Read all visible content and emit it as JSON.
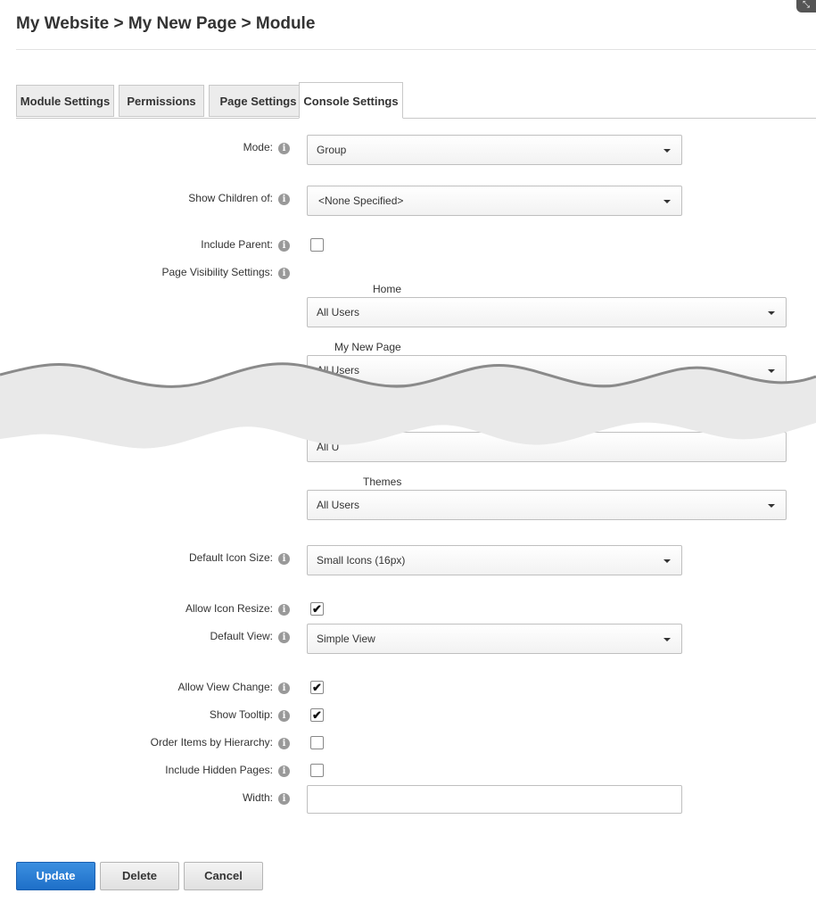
{
  "breadcrumb": "My Website > My New Page > Module",
  "tabs": [
    {
      "label": "Module Settings"
    },
    {
      "label": "Permissions"
    },
    {
      "label": "Page Settings"
    },
    {
      "label": "Console Settings"
    }
  ],
  "active_tab": "Console Settings",
  "form": {
    "mode": {
      "label": "Mode:",
      "value": "Group"
    },
    "show_children": {
      "label": "Show Children of:",
      "value": "<None Specified>"
    },
    "include_parent": {
      "label": "Include Parent:",
      "checked": false
    },
    "page_visibility": {
      "label": "Page Visibility Settings:",
      "pages": [
        {
          "name": "Home",
          "value": "All Users"
        },
        {
          "name": "My New Page",
          "value": "All Users"
        },
        {
          "name": "",
          "value": "All U"
        },
        {
          "name": "Themes",
          "value": "All Users"
        }
      ]
    },
    "default_icon_size": {
      "label": "Default Icon Size:",
      "value": "Small Icons (16px)"
    },
    "allow_icon_resize": {
      "label": "Allow Icon Resize:",
      "checked": true
    },
    "default_view": {
      "label": "Default View:",
      "value": "Simple View"
    },
    "allow_view_change": {
      "label": "Allow View Change:",
      "checked": true
    },
    "show_tooltip": {
      "label": "Show Tooltip:",
      "checked": true
    },
    "order_items": {
      "label": "Order Items by Hierarchy:",
      "checked": false
    },
    "include_hidden": {
      "label": "Include Hidden Pages:",
      "checked": false
    },
    "width": {
      "label": "Width:",
      "value": ""
    }
  },
  "buttons": {
    "update": "Update",
    "delete": "Delete",
    "cancel": "Cancel"
  },
  "checkmark": "✔",
  "info_glyph": "i",
  "icons": {
    "info": "info-icon",
    "caret": "chevron-down-icon",
    "corner": "collapse-icon"
  },
  "colors": {
    "primary_button": "#1e6fc8",
    "info_icon": "#999999"
  }
}
